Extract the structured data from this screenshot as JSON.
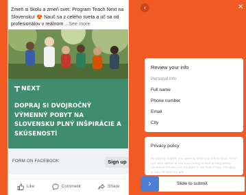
{
  "ad": {
    "primary_text": "Zmeň si školu a zmeň svet: Program Teach Next na Slovensku! 😍 Nauč sa z celého sveta a uč sa od profesionálov v reálnom",
    "see_more": "...See more",
    "brand": "NEXT",
    "headline": "DOPRAJ SI DVOJROČNÝ VÝMENNÝ POBYT NA SLOVENSKU PLNÝ INŠPIRÁCIE A SKÚSENOSTÍ",
    "form_label": "FORM ON FACEBOOK",
    "cta_label": "Sign up",
    "reactions": [
      {
        "icon": "thumbs-up-icon",
        "label": "Like"
      },
      {
        "icon": "comment-icon",
        "label": "Comment"
      },
      {
        "icon": "share-icon",
        "label": "Share"
      }
    ]
  },
  "form": {
    "review_title": "Review your info",
    "section_label": "Personal info",
    "fields": [
      "Full name",
      "Phone number",
      "Email",
      "City"
    ],
    "privacy_title": "Privacy policy",
    "privacy_text": "By clicking Submit, you agree to send your info to Dock Armor LLC who agrees to use it according to their privacy policy. Facebook will also use it subject to our Data Policy, including to auto-fill forms for ads.",
    "slide_label": "Slide to submit"
  },
  "colors": {
    "brand_orange": "#f25a24",
    "ad_green": "#3f8d6e",
    "slider_blue": "#4a7fd4"
  }
}
